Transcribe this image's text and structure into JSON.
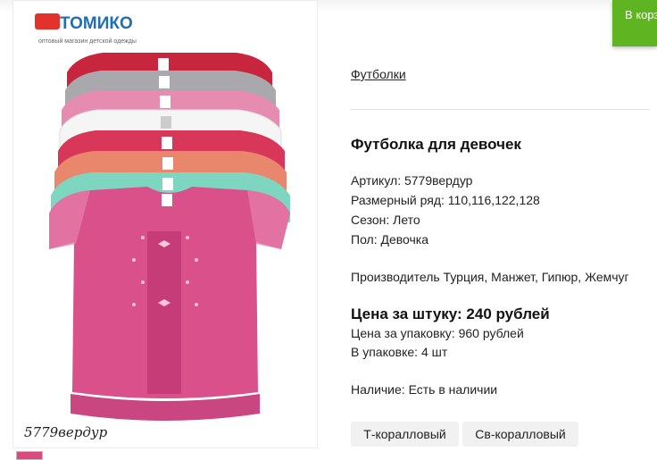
{
  "header": {
    "cart_notice": "В корз"
  },
  "brand": {
    "logo_text": "ТОМИКО",
    "tagline": "оптовый магазин детской одежды"
  },
  "image": {
    "caption": "5779вердур"
  },
  "product": {
    "category": "Футболки",
    "title": "Футболка для девочек",
    "article": "Артикул: 5779вердур",
    "sizes": "Размерный ряд: 110,116,122,128",
    "season": "Сезон: Лето",
    "gender": "Пол: Девочка",
    "maker": "Производитель Турция, Манжет, Гипюр, Жемчуг",
    "price_unit": "Цена за штуку: 240 рублей",
    "price_pack": "Цена за упаковку: 960 рублей",
    "pack_qty": "В упаковке: 4 шт",
    "availability": "Наличие: Есть в наличии"
  },
  "variants": [
    "Т-коралловый",
    "Св-коралловый"
  ],
  "colors": {
    "accent_green": "#5eb521",
    "shirt_colors": [
      "#c8253f",
      "#a9a9ad",
      "#e68cb0",
      "#f5f5f5",
      "#d8375a",
      "#e8876c",
      "#7fd6c0",
      "#d9508a"
    ]
  }
}
